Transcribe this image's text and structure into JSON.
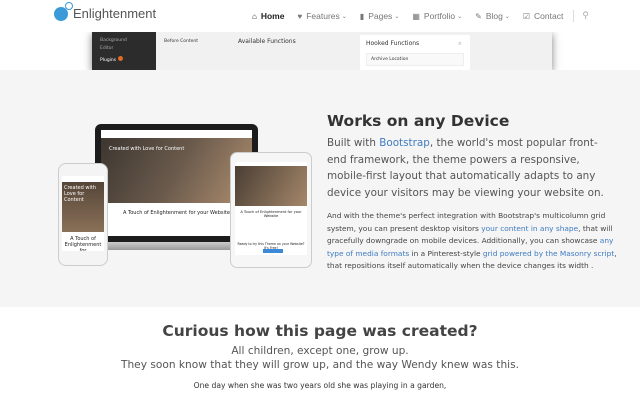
{
  "header": {
    "logo": "Enlightenment",
    "nav": [
      {
        "label": "Home",
        "icon": "home-icon",
        "active": true,
        "dropdown": false
      },
      {
        "label": "Features",
        "icon": "heart-icon",
        "dropdown": true
      },
      {
        "label": "Pages",
        "icon": "file-icon",
        "dropdown": true
      },
      {
        "label": "Portfolio",
        "icon": "grid-icon",
        "dropdown": true
      },
      {
        "label": "Blog",
        "icon": "pencil-icon",
        "dropdown": true
      },
      {
        "label": "Contact",
        "icon": "edit-icon",
        "dropdown": false
      }
    ],
    "search_icon": "search-icon"
  },
  "admin_shot": {
    "side1": "Background",
    "side2": "Editor",
    "plugins": "Plugins",
    "before": "Before Content",
    "available": "Available Functions",
    "hooked": "Hooked Functions",
    "close": "×",
    "archive": "Archive Location"
  },
  "devices": {
    "hero": "Created with Love for Content",
    "caption": "A Touch of Enlightenment for your Website",
    "phone_caption": "A Touch of Enlightenment for",
    "tablet_cta": "Ready to try this Theme on your Website? It's Free!"
  },
  "device_section": {
    "title": "Works on any Device",
    "p1_a": "Built with ",
    "p1_link": "Bootstrap",
    "p1_b": ", the world's most popular front-end framework, the theme powers a responsive, mobile-first layout that automatically adapts to any device your visitors may be viewing your website on.",
    "p2_a": "And with the theme's perfect integration with Bootstrap's multicolumn grid system, you can present desktop visitors ",
    "p2_link1": "your content in any shape",
    "p2_b": ", that will gracefully downgrade on mobile devices. Additionally, you can showcase ",
    "p2_link2": "any type of media formats",
    "p2_c": " in a Pinterest-style ",
    "p2_link3": "grid powered by the Masonry script",
    "p2_d": ", that repositions itself automatically when the device changes its width ."
  },
  "story": {
    "title": "Curious how this page was created?",
    "line1": "All children, except one, grow up.",
    "line2": "They soon know that they will grow up, and the way Wendy knew was this.",
    "line3": "One day when she was two years old she was playing in a garden,"
  },
  "colors": {
    "link": "#3f7bc2",
    "accent": "#3a9bd8"
  }
}
